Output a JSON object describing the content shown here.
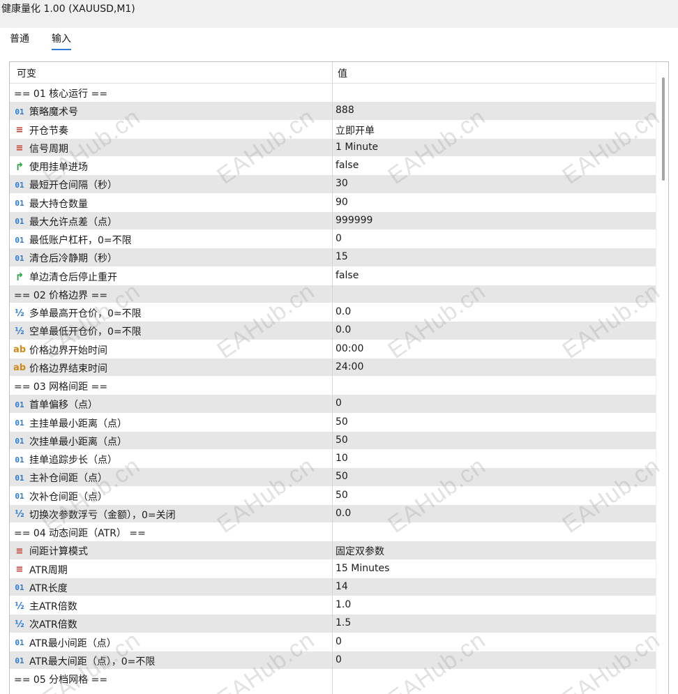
{
  "window": {
    "title": "健康量化 1.00 (XAUUSD,M1)"
  },
  "tabs": [
    {
      "label": "普通",
      "active": false
    },
    {
      "label": "输入",
      "active": true
    }
  ],
  "table": {
    "headers": {
      "name": "可变",
      "value": "值"
    },
    "rows": [
      {
        "type": "section",
        "name": "== 01 核心运行 ==",
        "value": ""
      },
      {
        "type": "int",
        "name": "策略魔术号",
        "value": "888"
      },
      {
        "type": "enum",
        "name": "开仓节奏",
        "value": "立即开单"
      },
      {
        "type": "enum",
        "name": "信号周期",
        "value": "1 Minute"
      },
      {
        "type": "bool",
        "name": "使用挂单进场",
        "value": "false"
      },
      {
        "type": "int",
        "name": "最短开仓间隔（秒）",
        "value": "30"
      },
      {
        "type": "int",
        "name": "最大持仓数量",
        "value": "90"
      },
      {
        "type": "int",
        "name": "最大允许点差（点）",
        "value": "999999"
      },
      {
        "type": "int",
        "name": "最低账户杠杆，0=不限",
        "value": "0"
      },
      {
        "type": "int",
        "name": "清仓后冷静期（秒）",
        "value": "15"
      },
      {
        "type": "bool",
        "name": "单边清仓后停止重开",
        "value": "false"
      },
      {
        "type": "section",
        "name": "== 02 价格边界 ==",
        "value": ""
      },
      {
        "type": "double",
        "name": "多单最高开仓价，0=不限",
        "value": "0.0"
      },
      {
        "type": "double",
        "name": "空单最低开仓价，0=不限",
        "value": "0.0"
      },
      {
        "type": "string",
        "name": "价格边界开始时间",
        "value": "00:00"
      },
      {
        "type": "string",
        "name": "价格边界结束时间",
        "value": "24:00"
      },
      {
        "type": "section",
        "name": "== 03 网格间距 ==",
        "value": ""
      },
      {
        "type": "int",
        "name": "首单偏移（点）",
        "value": "0"
      },
      {
        "type": "int",
        "name": "主挂单最小距离（点）",
        "value": "50"
      },
      {
        "type": "int",
        "name": "次挂单最小距离（点）",
        "value": "50"
      },
      {
        "type": "int",
        "name": "挂单追踪步长（点）",
        "value": "10"
      },
      {
        "type": "int",
        "name": "主补仓间距（点）",
        "value": "50"
      },
      {
        "type": "int",
        "name": "次补仓间距（点）",
        "value": "50"
      },
      {
        "type": "double",
        "name": "切换次参数浮亏（金额），0=关闭",
        "value": "0.0"
      },
      {
        "type": "section",
        "name": "== 04 动态间距（ATR） ==",
        "value": ""
      },
      {
        "type": "enum",
        "name": "间距计算模式",
        "value": "固定双参数"
      },
      {
        "type": "enum",
        "name": "ATR周期",
        "value": "15 Minutes"
      },
      {
        "type": "int",
        "name": "ATR长度",
        "value": "14"
      },
      {
        "type": "double",
        "name": "主ATR倍数",
        "value": "1.0"
      },
      {
        "type": "double",
        "name": "次ATR倍数",
        "value": "1.5"
      },
      {
        "type": "int",
        "name": "ATR最小间距（点）",
        "value": "0"
      },
      {
        "type": "int",
        "name": "ATR最大间距（点），0=不限",
        "value": "0"
      },
      {
        "type": "section",
        "name": "== 05 分档网格 ==",
        "value": ""
      }
    ]
  },
  "icons": {
    "int": {
      "glyph": "01",
      "name": "integer-type-icon"
    },
    "enum": {
      "glyph": "≡",
      "name": "enum-list-icon"
    },
    "bool": {
      "glyph": "↱",
      "name": "boolean-arrow-icon"
    },
    "double": {
      "glyph": "½",
      "name": "double-fraction-icon"
    },
    "string": {
      "glyph": "ab",
      "name": "string-type-icon"
    }
  },
  "watermark": "EAHub.cn"
}
